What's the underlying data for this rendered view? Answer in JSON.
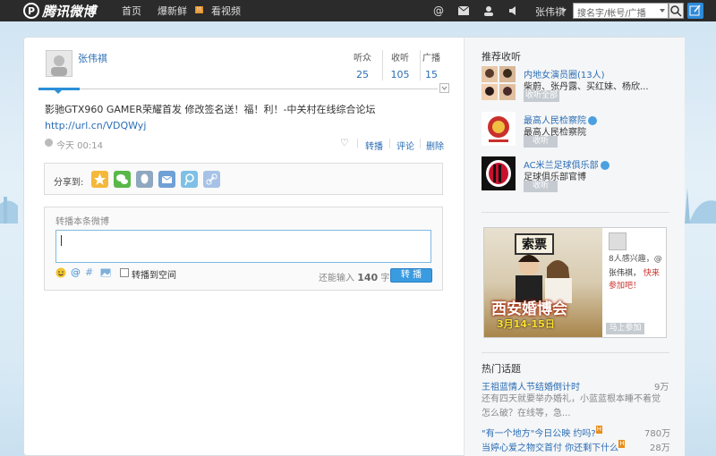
{
  "topbar": {
    "logo_text": "腾讯微博",
    "nav": [
      "首页",
      "爆新鲜",
      "看视频"
    ],
    "nav_badge": "热",
    "user_name": "张伟祺",
    "search_placeholder": "搜名字/帐号/广播"
  },
  "profile": {
    "name": "张伟祺",
    "stats": [
      {
        "label": "听众",
        "value": "25"
      },
      {
        "label": "收听",
        "value": "105"
      },
      {
        "label": "广播",
        "value": "15"
      }
    ]
  },
  "post": {
    "text": "影驰GTX960 GAMER荣耀首发 修改签名送！福！利！-中关村在线综合论坛",
    "link": "http://url.cn/VDQWyj",
    "time": "今天 00:14",
    "actions": [
      "转播",
      "评论",
      "删除"
    ]
  },
  "share": {
    "label": "分享到:",
    "icons": [
      "qzone-icon",
      "wechat-icon",
      "qq-icon",
      "mail-icon",
      "tencent-weibo-icon",
      "link-icon"
    ]
  },
  "forward": {
    "title": "转播本条微博",
    "checkbox_label": "转播到空间",
    "limit_prefix": "还能输入",
    "limit_count": "140",
    "limit_suffix": "字",
    "button_label": "转 播"
  },
  "sidebar": {
    "recommend_title": "推荐收听",
    "recommend": [
      {
        "name": "内地女演员圈(13人)",
        "desc": "柴蔚、张丹露、买红妹、杨欣...",
        "button": "收听全部",
        "verified": false
      },
      {
        "name": "最高人民检察院",
        "desc": "最高人民检察院",
        "button": "收听",
        "verified": true
      },
      {
        "name": "AC米兰足球俱乐部",
        "desc": "足球俱乐部官博",
        "button": "收听",
        "verified": true
      }
    ],
    "ad": {
      "ticket": "索票",
      "title": "西安婚博会",
      "date": "3月14-15日",
      "line1": "8人感兴趣，@",
      "line2_name": "张伟祺，",
      "line2_rest": "快来",
      "line3": "参加吧！",
      "button": "马上参加"
    },
    "topics_title": "热门话题",
    "topics": [
      {
        "title": "王祖蓝情人节结婚倒计时",
        "count": "9万",
        "desc": "还有四天就要举办婚礼，小蓝蓝根本睡不着觉怎么破？在线等，急..."
      },
      {
        "title": "\"有一个地方\"今日公映 约吗?",
        "count": "780万",
        "badge": "H"
      },
      {
        "title": "当婷心爱之物交首付 你还剩下什么",
        "count": "28万",
        "badge": "H"
      }
    ]
  }
}
